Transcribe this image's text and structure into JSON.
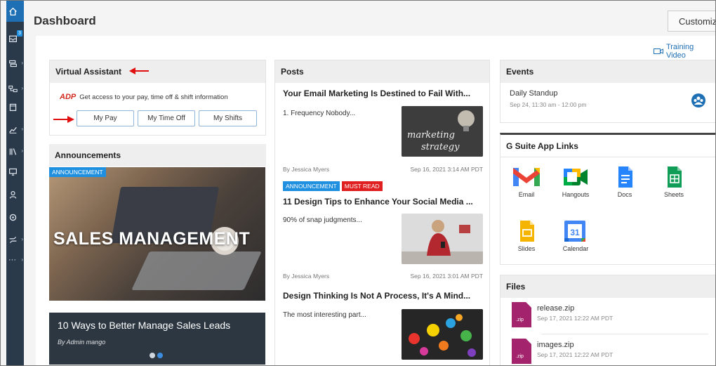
{
  "header": {
    "title": "Dashboard",
    "customize_label": "Customize"
  },
  "training_video": {
    "label": "Training Video"
  },
  "sidebar": {
    "badge": "3",
    "more": "···"
  },
  "virtual_assistant": {
    "title": "Virtual Assistant",
    "brand": "ADP",
    "description": "Get access to your pay, time off & shift information",
    "buttons": [
      "My Pay",
      "My Time Off",
      "My Shifts"
    ]
  },
  "announcements": {
    "title": "Announcements",
    "tag": "ANNOUNCEMENT",
    "image_text": "SALES MANAGEMENT",
    "card_title": "10 Ways to Better Manage Sales Leads",
    "byline": "By Admin mango"
  },
  "posts": {
    "title": "Posts",
    "items": [
      {
        "title": "Your Email Marketing Is Destined to Fail With...",
        "excerpt": "1. Frequency Nobody...",
        "author": "By Jessica Myers",
        "date": "Sep 16, 2021 3:14 AM PDT",
        "image_text": "marketing strategy"
      },
      {
        "tags": [
          "ANNOUNCEMENT",
          "MUST READ"
        ],
        "title": "11 Design Tips to Enhance Your Social Media ...",
        "excerpt": "90% of snap judgments...",
        "author": "By Jessica Myers",
        "date": "Sep 16, 2021 3:01 AM PDT"
      },
      {
        "title": "Design Thinking Is Not A Process, It's A Mind...",
        "excerpt": "The most interesting part..."
      }
    ]
  },
  "events": {
    "title": "Events",
    "items": [
      {
        "name": "Daily Standup",
        "time": "Sep 24, 11:30 am - 12:00 pm"
      }
    ]
  },
  "gsuite": {
    "title": "G Suite App Links",
    "apps": [
      "Email",
      "Hangouts",
      "Docs",
      "Sheets",
      "Slides",
      "Calendar"
    ],
    "calendar_day": "31"
  },
  "files": {
    "title": "Files",
    "ext_label": ".zip",
    "items": [
      {
        "name": "release.zip",
        "date": "Sep 17, 2021 12:22 AM PDT"
      },
      {
        "name": "images.zip",
        "date": "Sep 17, 2021 12:22 AM PDT"
      }
    ]
  },
  "colors": {
    "sidebar": "#2b3a4b",
    "accent": "#1f6fb5",
    "tag_blue": "#1f8fe0",
    "tag_red": "#e02020",
    "zip": "#a3246c"
  }
}
